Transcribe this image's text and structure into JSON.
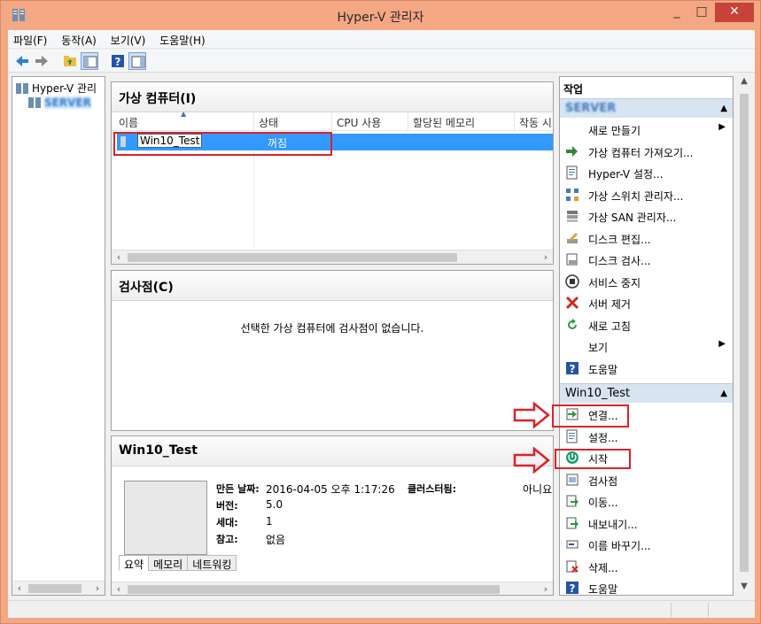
{
  "window": {
    "title": "Hyper-V 관리자",
    "minimize": "_",
    "maximize": "□",
    "close": "✕"
  },
  "menu": [
    "파일(F)",
    "동작(A)",
    "보기(V)",
    "도움말(H)"
  ],
  "tree": {
    "root": "Hyper-V 관리",
    "server": "SERVER"
  },
  "vm_pane": {
    "title": "가상 컴퓨터(I)",
    "columns": [
      "이름",
      "상태",
      "CPU 사용",
      "할당된 메모리",
      "작동 시"
    ],
    "rows": [
      {
        "name": "Win10_Test",
        "state": "꺼짐"
      }
    ]
  },
  "checkpoint_pane": {
    "title": "검사점(C)",
    "empty_message": "선택한 가상 컴퓨터에 검사점이 없습니다."
  },
  "detail_pane": {
    "title": "Win10_Test",
    "created_label": "만든 날짜:",
    "created_value": "2016-04-05 오후 1:17:26",
    "cluster_label": "클러스터됨:",
    "cluster_value": "아니요",
    "version_label": "버전:",
    "version_value": "5.0",
    "generation_label": "세대:",
    "generation_value": "1",
    "notes_label": "참고:",
    "notes_value": "없음",
    "tabs": [
      "요약",
      "메모리",
      "네트워킹"
    ]
  },
  "actions": {
    "title": "작업",
    "server_group": "SERVER",
    "server_items": [
      {
        "label": "새로 만들기",
        "icon": "blank-icon",
        "submenu": true
      },
      {
        "label": "가상 컴퓨터 가져오기...",
        "icon": "import-icon"
      },
      {
        "label": "Hyper-V 설정...",
        "icon": "settings-icon"
      },
      {
        "label": "가상 스위치 관리자...",
        "icon": "switch-icon"
      },
      {
        "label": "가상 SAN 관리자...",
        "icon": "san-icon"
      },
      {
        "label": "디스크 편집...",
        "icon": "edit-disk-icon"
      },
      {
        "label": "디스크 검사...",
        "icon": "inspect-disk-icon"
      },
      {
        "label": "서비스 중지",
        "icon": "stop-icon"
      },
      {
        "label": "서버 제거",
        "icon": "remove-icon"
      },
      {
        "label": "새로 고침",
        "icon": "refresh-icon"
      },
      {
        "label": "보기",
        "icon": "blank-icon",
        "submenu": true
      },
      {
        "label": "도움말",
        "icon": "help-icon"
      }
    ],
    "vm_group": "Win10_Test",
    "vm_items": [
      {
        "label": "연결...",
        "icon": "connect-icon"
      },
      {
        "label": "설정...",
        "icon": "settings-icon"
      },
      {
        "label": "시작",
        "icon": "start-icon"
      },
      {
        "label": "검사점",
        "icon": "checkpoint-icon"
      },
      {
        "label": "이동...",
        "icon": "move-icon"
      },
      {
        "label": "내보내기...",
        "icon": "export-icon"
      },
      {
        "label": "이름 바꾸기...",
        "icon": "rename-icon"
      },
      {
        "label": "삭제...",
        "icon": "delete-icon"
      },
      {
        "label": "도움말",
        "icon": "help-icon"
      }
    ]
  },
  "colors": {
    "accent": "#3399ff",
    "annotation": "#e0202a",
    "frame": "#f3a782"
  }
}
